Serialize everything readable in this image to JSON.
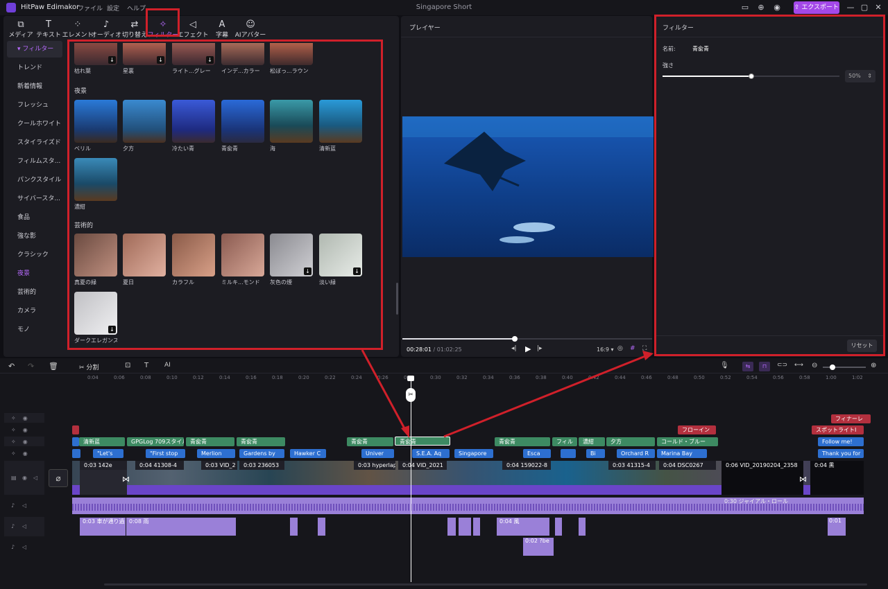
{
  "titlebar": {
    "app_name": "HitPaw Edimakor",
    "menus": [
      "ファイル",
      "設定",
      "ヘルプ"
    ],
    "project_title": "Singapore Short",
    "export_label": "エクスポート"
  },
  "toolbar": {
    "tools": [
      {
        "label": "メディア",
        "icon": "media-icon"
      },
      {
        "label": "テキスト",
        "icon": "text-icon"
      },
      {
        "label": "エレメント",
        "icon": "element-icon"
      },
      {
        "label": "オーディオ",
        "icon": "audio-icon"
      },
      {
        "label": "切り替え",
        "icon": "transition-icon"
      },
      {
        "label": "フィルター",
        "icon": "filter-icon"
      },
      {
        "label": "エフェクト",
        "icon": "effect-icon"
      },
      {
        "label": "字幕",
        "icon": "subtitle-icon"
      },
      {
        "label": "AIアバター",
        "icon": "avatar-icon"
      }
    ]
  },
  "sidebar": {
    "header": "フィルター",
    "items": [
      "トレンド",
      "新着情報",
      "フレッシュ",
      "クールホワイト",
      "スタイライズド",
      "フィルムスタ...",
      "パンクスタイル",
      "サイバースタ...",
      "食品",
      "強な影",
      "クラシック",
      "夜景",
      "芸術的",
      "カメラ",
      "モノ"
    ]
  },
  "filters": {
    "top_row": [
      "枯れ葉",
      "星裏",
      "ライト...グレー",
      "インデ...カラー",
      "松ぼっ...ラウン"
    ],
    "night_title": "夜景",
    "night_items": [
      "ベリル",
      "夕方",
      "冷たい青",
      "青兪青",
      "海",
      "清新蓝",
      "濃紺"
    ],
    "art_title": "芸術的",
    "art_items": [
      "真夏の緑",
      "夏日",
      "カラフル",
      "ミルキ...モンド",
      "灰色の煙",
      "淡い緑",
      "ダークエレガンス"
    ]
  },
  "player": {
    "title": "プレイヤー",
    "current_time": "00:28:01",
    "total_time": "01:02:25",
    "aspect": "16:9",
    "progress": 0.45
  },
  "filter_panel": {
    "title": "フィルター",
    "name_label": "名前:",
    "name_value": "青兪青",
    "strength_label": "強さ",
    "strength_value": "50%",
    "strength": 0.5,
    "reset_label": "リセット"
  },
  "timeline": {
    "split_label": "分割",
    "ruler": [
      "0:04",
      "0:06",
      "0:08",
      "0:10",
      "0:12",
      "0:14",
      "0:16",
      "0:18",
      "0:20",
      "0:22",
      "0:24",
      "0:26",
      "0:28",
      "0:30",
      "0:32",
      "0:34",
      "0:36",
      "0:38",
      "0:40",
      "0:42",
      "0:44",
      "0:46",
      "0:48",
      "0:50",
      "0:52",
      "0:54",
      "0:56",
      "0:58",
      "1:00",
      "1:02"
    ],
    "red_clips": [
      "フローイン",
      "スポットライトI",
      "フィナーレ"
    ],
    "green_clips": [
      "清新蓝",
      "GPGLog 709スタイル",
      "青兪青",
      "青兪青",
      "青兪青",
      "青兪青",
      "青兪青",
      "フィル",
      "濃紺",
      "夕方",
      "コールド・ブルー"
    ],
    "text_clips": [
      "\"Let's",
      "\"First stop",
      "Merlion",
      "Gardens by",
      "Hawker C",
      "Univer",
      "S.E.A. Aq",
      "Singapore",
      "Esca",
      "Bi",
      "Orchard R",
      "Marina Bay",
      "Follow me!",
      "Thank you for"
    ],
    "video_clips": [
      "0:03 142e",
      "0:04 41308-4",
      "0:03 VID_2",
      "0:03 236053",
      "0:03 hyperlap",
      "0:04 VID_2021",
      "0:04 159022-8",
      "0:03 41315-4",
      "0:04 DSC0267",
      "0:06 VID_20190204_2358",
      "0:04 黒"
    ],
    "audio_labels": [
      "0:03 車が通り過",
      "0:08 雨",
      "0:04 風",
      "0:02 ?be",
      "0:01"
    ],
    "music_label": "0:30 ジャイアル・ロール"
  }
}
